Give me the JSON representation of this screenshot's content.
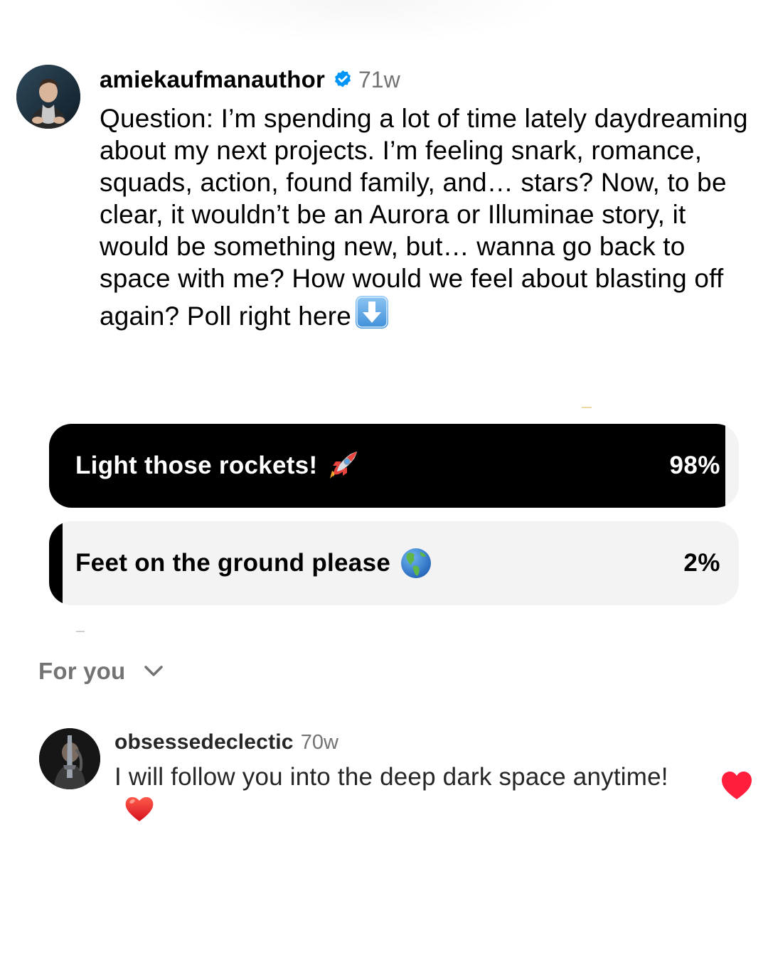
{
  "post": {
    "username": "amiekaufmanauthor",
    "verified": true,
    "age": "71w",
    "caption": "Question: I’m spending a lot of time lately daydreaming about my next projects. I’m feeling snark, romance, squads, action, found family, and… stars? Now, to be clear, it wouldn’t be an Aurora or Illuminae story, it would be something new, but… wanna go back to space with me? How would we feel about blasting off again? Poll right here",
    "caption_end_icon": "down-arrow-emoji",
    "avatar_icon": "profile-photo"
  },
  "poll": {
    "options": [
      {
        "label": "Light those rockets!",
        "icon": "rocket-emoji",
        "percent_text": "98%",
        "percent": 98
      },
      {
        "label": "Feet on the ground please",
        "icon": "globe-emoji",
        "percent_text": "2%",
        "percent": 2
      }
    ],
    "fill_color": "#000000",
    "track_color": "#f3f3f3"
  },
  "comments_sort": {
    "label": "For you",
    "icon": "chevron-down-icon"
  },
  "comments": [
    {
      "username": "obsessedeclectic",
      "age": "70w",
      "text": "I will follow you into the deep dark space anytime!",
      "text_end_icon": "red-heart-emoji",
      "liked": true,
      "like_icon": "heart-icon",
      "like_color": "#ff3040"
    }
  ],
  "colors": {
    "verified_badge": "#0095f6",
    "secondary_text": "#737373"
  }
}
